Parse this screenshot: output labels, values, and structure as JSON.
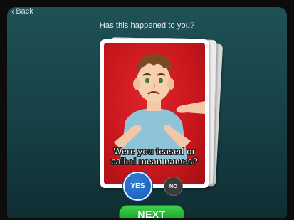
{
  "header": {
    "back_label": "Back",
    "back_icon": "chevron-left-icon",
    "question": "Has this happened to you?"
  },
  "card": {
    "caption": "Were you teased or called mean names?",
    "illustration": "sad-boy-with-pointing-fingers"
  },
  "answers": {
    "yes_label": "YES",
    "no_label": "NO"
  },
  "footer": {
    "next_label": "NEXT"
  },
  "colors": {
    "background": "#1e5155",
    "card_red": "#c8161d",
    "yes_blue": "#1a5bb4",
    "no_gray": "#3b3b3b",
    "next_green": "#24b532"
  }
}
